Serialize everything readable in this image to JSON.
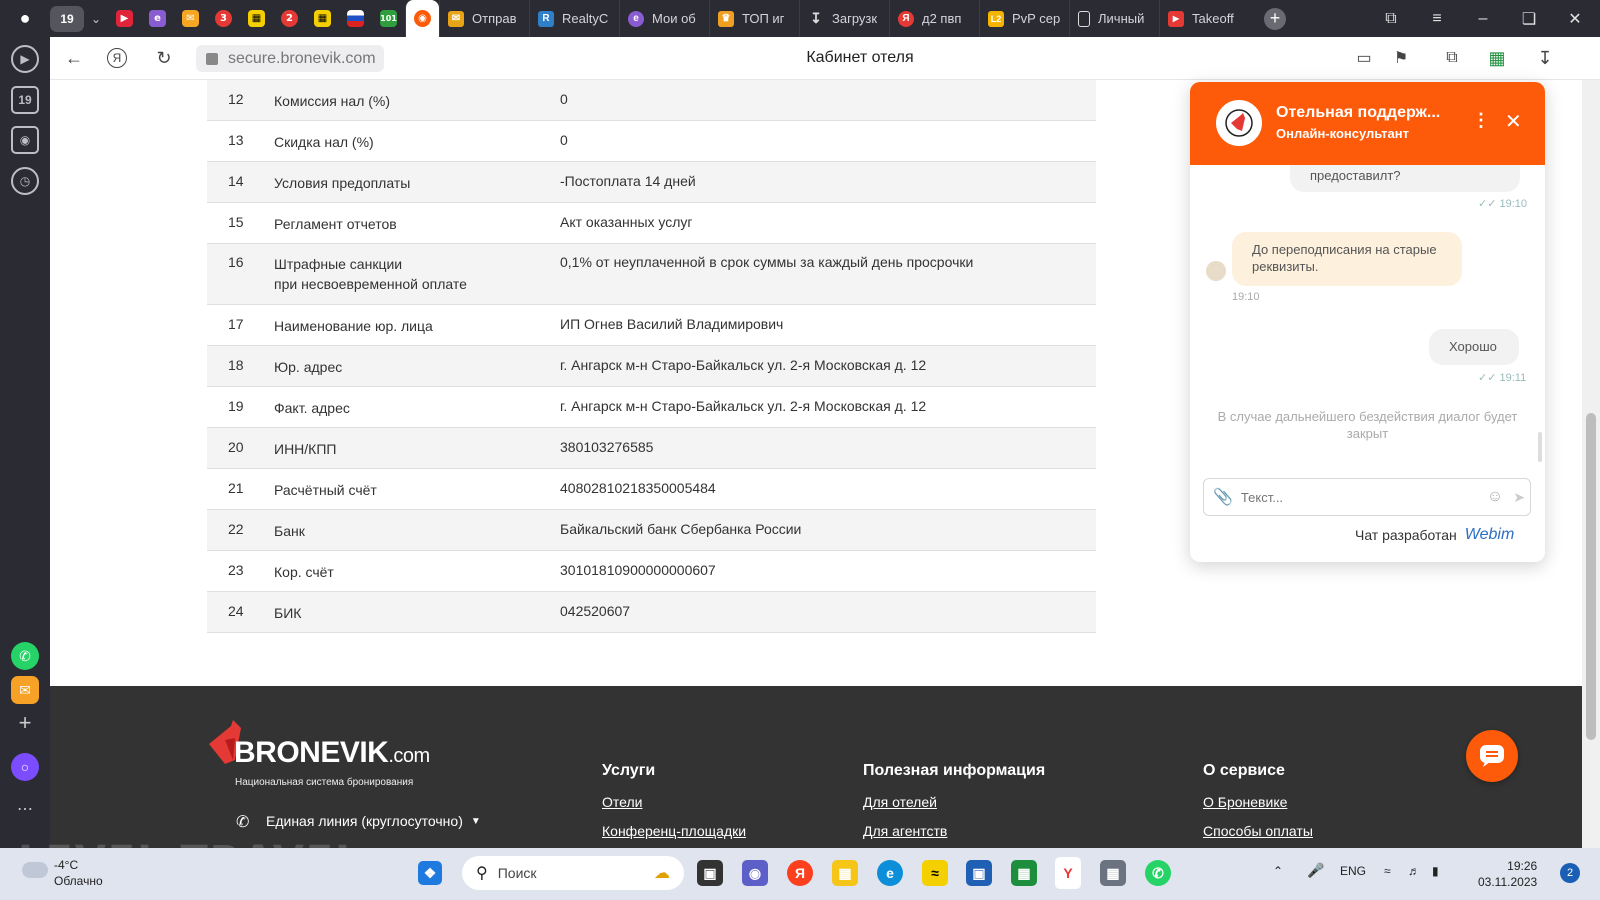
{
  "browser": {
    "tab_count": "19",
    "tabs": [
      {
        "label": "Отправ",
        "color": "#e8a317"
      },
      {
        "label": "RealtyC",
        "color": "#2f80c8"
      },
      {
        "label": "Мои об",
        "color": "#8a5cd1"
      },
      {
        "label": "ТОП иг",
        "color": "#f0a020"
      },
      {
        "label": "Загрузк",
        "color": "#cccccc"
      },
      {
        "label": "д2 пвп",
        "color": "#e53935"
      },
      {
        "label": "PvP сер",
        "color": "#f5b400"
      },
      {
        "label": "Личный",
        "color": "#cccccc"
      },
      {
        "label": "Takeoff",
        "color": "#e53935"
      }
    ],
    "url": "secure.bronevik.com",
    "page_title": "Кабинет отеля"
  },
  "table": {
    "rows": [
      {
        "num": "12",
        "label": "Комиссия нал (%)",
        "label2": "",
        "value": "0"
      },
      {
        "num": "13",
        "label": "Скидка нал (%)",
        "label2": "",
        "value": "0"
      },
      {
        "num": "14",
        "label": "Условия предоплаты",
        "label2": "",
        "value": "-Постоплата 14 дней"
      },
      {
        "num": "15",
        "label": "Регламент отчетов",
        "label2": "",
        "value": "Акт оказанных услуг"
      },
      {
        "num": "16",
        "label": "Штрафные санкции",
        "label2": "при несвоевременной оплате",
        "value": "0,1% от неуплаченной в срок суммы за каждый день просрочки"
      },
      {
        "num": "17",
        "label": "Наименование юр. лица",
        "label2": "",
        "value": "ИП Огнев Василий Владимирович"
      },
      {
        "num": "18",
        "label": "Юр. адрес",
        "label2": "",
        "value": "г. Ангарск м-н Старо-Байкальск ул. 2-я Московская д. 12"
      },
      {
        "num": "19",
        "label": "Факт. адрес",
        "label2": "",
        "value": "г. Ангарск м-н Старо-Байкальск ул. 2-я Московская д. 12"
      },
      {
        "num": "20",
        "label": "ИНН/КПП",
        "label2": "",
        "value": "380103276585"
      },
      {
        "num": "21",
        "label": "Расчётный счёт",
        "label2": "",
        "value": "40802810218350005484"
      },
      {
        "num": "22",
        "label": "Банк",
        "label2": "",
        "value": "Байкальский банк Сбербанка России"
      },
      {
        "num": "23",
        "label": "Кор. счёт",
        "label2": "",
        "value": "30101810900000000607"
      },
      {
        "num": "24",
        "label": "БИК",
        "label2": "",
        "value": "042520607"
      }
    ]
  },
  "footer": {
    "logo_main": "BRONEVIK",
    "logo_domain": ".com",
    "logo_sub": "Национальная система бронирования",
    "phone_line": "Единая линия (круглосуточно)",
    "columns": [
      {
        "title": "Услуги",
        "links": [
          "Отели",
          "Конференц-площадки"
        ]
      },
      {
        "title": "Полезная информация",
        "links": [
          "Для отелей",
          "Для агентств"
        ]
      },
      {
        "title": "О сервисе",
        "links": [
          "О Броневике",
          "Способы оплаты"
        ]
      }
    ],
    "watermark": "LEVEL TRAVEL"
  },
  "chat": {
    "title": "Отельная поддерж...",
    "subtitle": "Онлайн-консультант",
    "messages": [
      {
        "text": "предоставилт?",
        "time": "19:10",
        "side": "out"
      },
      {
        "text": "До переподписания на старые реквизиты.",
        "time": "19:10",
        "side": "in"
      },
      {
        "text": "Хорошо",
        "time": "19:11",
        "side": "out"
      }
    ],
    "system_notice": "В случае дальнейшего бездействия диалог будет закрыт",
    "input_placeholder": "Текст...",
    "powered_by": "Чат разработан",
    "powered_brand": "Webim"
  },
  "taskbar": {
    "weather_temp": "-4°C",
    "weather_cond": "Облачно",
    "search_label": "Поиск",
    "lang": "ENG",
    "time": "19:26",
    "date": "03.11.2023",
    "notifications": "2"
  }
}
